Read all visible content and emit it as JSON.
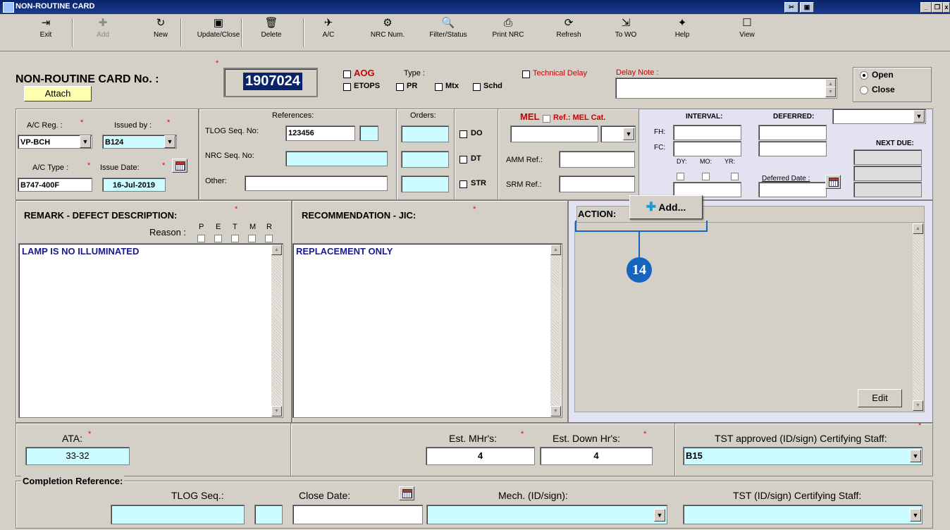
{
  "window": {
    "title": "NON-ROUTINE CARD"
  },
  "toolbar": [
    {
      "label": "Exit",
      "icon": "exit-icon",
      "glyph": "⇥",
      "disabled": false
    },
    {
      "label": "Add",
      "icon": "add-icon",
      "glyph": "✚",
      "disabled": true
    },
    {
      "label": "New",
      "icon": "new-icon",
      "glyph": "↻",
      "disabled": false
    },
    {
      "label": "Update/Close",
      "icon": "save-icon",
      "glyph": "▣",
      "disabled": false
    },
    {
      "label": "Delete",
      "icon": "trash-icon",
      "glyph": "🗑",
      "disabled": false
    },
    {
      "label": "A/C",
      "icon": "aircraft-icon",
      "glyph": "✈",
      "disabled": false
    },
    {
      "label": "NRC Num.",
      "icon": "number-icon",
      "glyph": "⚙",
      "disabled": false
    },
    {
      "label": "Filter/Status",
      "icon": "magnifier-icon",
      "glyph": "🔍",
      "disabled": false
    },
    {
      "label": "Print NRC",
      "icon": "printer-icon",
      "glyph": "⎙",
      "disabled": false
    },
    {
      "label": "Refresh",
      "icon": "refresh-icon",
      "glyph": "⟳",
      "disabled": false
    },
    {
      "label": "To WO",
      "icon": "to-wo-icon",
      "glyph": "⇲",
      "disabled": false
    },
    {
      "label": "Help",
      "icon": "help-icon",
      "glyph": "✦",
      "disabled": false
    },
    {
      "label": "View",
      "icon": "view-icon",
      "glyph": "☐",
      "disabled": false
    }
  ],
  "header": {
    "card_label": "NON-ROUTINE CARD No. :",
    "card_number": "1907024",
    "attach": "Attach",
    "aog": "AOG",
    "etops": "ETOPS",
    "type_label": "Type :",
    "pr": "PR",
    "mtx": "Mtx",
    "schd": "Schd",
    "technical_delay": "Technical Delay",
    "delay_note": "Delay Note :",
    "open": "Open",
    "close": "Close"
  },
  "aircraft": {
    "reg_label": "A/C Reg. :",
    "reg_value": "VP-BCH",
    "issued_label": "Issued by :",
    "issued_value": "B124",
    "type_label": "A/C Type :",
    "type_value": "B747-400F",
    "issue_date_label": "Issue Date:",
    "issue_date_value": "16-Jul-2019"
  },
  "references": {
    "title": "References:",
    "tlog_label": "TLOG Seq. No:",
    "tlog_value": "123456",
    "nrc_label": "NRC Seq. No:",
    "other_label": "Other:",
    "orders": "Orders:",
    "do": "DO",
    "dt": "DT",
    "str": "STR"
  },
  "mel": {
    "mel": "MEL",
    "ref_label": "Ref.: MEL Cat.",
    "amm_label": "AMM Ref.:",
    "srm_label": "SRM Ref.:"
  },
  "interval": {
    "interval": "INTERVAL:",
    "deferred": "DEFERRED:",
    "fh": "FH:",
    "fc": "FC:",
    "dy": "DY:",
    "mo": "MO:",
    "yr": "YR:",
    "deferred_date": "Deferred Date :",
    "next_due": "NEXT DUE:"
  },
  "remark": {
    "title": "REMARK - DEFECT DESCRIPTION:",
    "reason": "Reason :",
    "reason_letters": [
      "P",
      "E",
      "T",
      "M",
      "R"
    ],
    "text": "LAMP IS NO ILLUMINATED"
  },
  "recommendation": {
    "title": "RECOMMENDATION - JIC:",
    "text": "REPLACEMENT ONLY"
  },
  "action": {
    "title": "ACTION:",
    "add": "Add...",
    "callout": "14",
    "edit": "Edit"
  },
  "bottom": {
    "ata_label": "ATA:",
    "ata_value": "33-32",
    "est_mhr_label": "Est. MHr's:",
    "est_mhr_value": "4",
    "est_down_label": "Est. Down Hr's:",
    "est_down_value": "4",
    "tst_label": "TST approved (ID/sign) Certifying Staff:",
    "tst_value": "B15"
  },
  "completion": {
    "title": "Completion Reference:",
    "tlog_seq": "TLOG Seq.:",
    "close_date": "Close Date:",
    "mech": "Mech. (ID/sign):",
    "tst": "TST (ID/sign) Certifying Staff:"
  },
  "colors": {
    "field_cyan": "#ccfcff",
    "title_blue": "#0a246a",
    "callout_blue": "#1565c0",
    "required_red": "#e00000"
  }
}
